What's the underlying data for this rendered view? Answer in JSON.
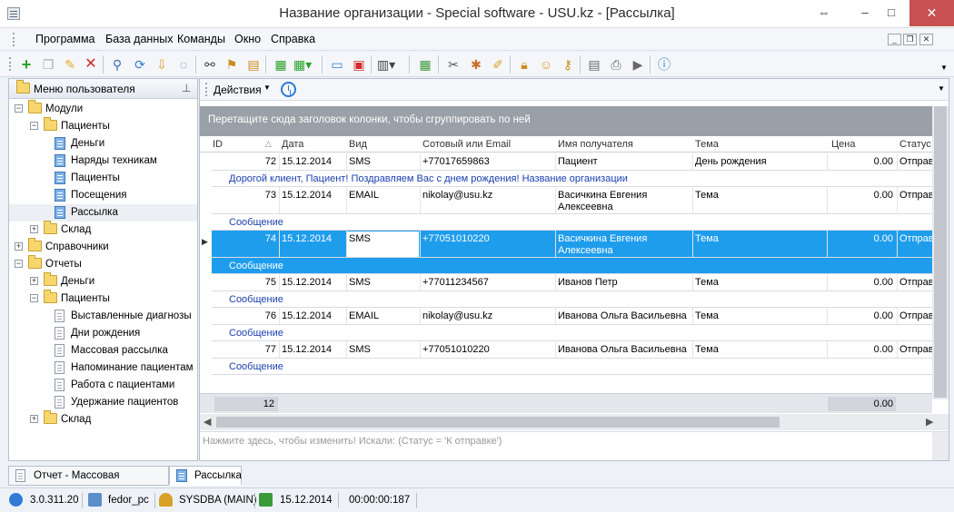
{
  "window": {
    "title": "Название организации - Special software - USU.kz - [Рассылка]",
    "controls": {
      "resize": "⇔",
      "minimize": "–",
      "maximize": "□",
      "close": "✕"
    }
  },
  "menu": {
    "items": [
      "Программа",
      "База данных",
      "Команды",
      "Окно",
      "Справка"
    ],
    "mdi": {
      "minimize": "_",
      "restore": "❐",
      "close": "✕"
    }
  },
  "toolbar": {
    "icons": [
      "add-icon",
      "copy-icon",
      "edit-icon",
      "delete-icon",
      "search-icon",
      "refresh-icon",
      "import-icon",
      "comment-icon",
      "binoculars-icon",
      "filter-icon",
      "export-icon",
      "excel-icon",
      "export-menu-icon",
      "window-icon",
      "window-add-icon",
      "column-icon",
      "calendar-icon",
      "tools-icon",
      "paint-icon",
      "notepad-icon",
      "lock-icon",
      "users-icon",
      "key-icon",
      "grid-icon",
      "print-icon",
      "play-icon",
      "info-icon"
    ]
  },
  "left_panel": {
    "title": "Меню пользователя",
    "pin": "⊥",
    "tree": [
      {
        "label": "Модули",
        "level": 0,
        "expander": "−",
        "icon": "folder"
      },
      {
        "label": "Пациенты",
        "level": 1,
        "expander": "−",
        "icon": "folder"
      },
      {
        "label": "Деньги",
        "level": 2,
        "expander": "",
        "icon": "doc-blue"
      },
      {
        "label": "Наряды техникам",
        "level": 2,
        "expander": "",
        "icon": "doc-blue"
      },
      {
        "label": "Пациенты",
        "level": 2,
        "expander": "",
        "icon": "doc-blue"
      },
      {
        "label": "Посещения",
        "level": 2,
        "expander": "",
        "icon": "doc-blue"
      },
      {
        "label": "Рассылка",
        "level": 2,
        "expander": "",
        "icon": "doc-blue",
        "selected": true
      },
      {
        "label": "Склад",
        "level": 1,
        "expander": "+",
        "icon": "folder"
      },
      {
        "label": "Справочники",
        "level": 0,
        "expander": "+",
        "icon": "folder"
      },
      {
        "label": "Отчеты",
        "level": 0,
        "expander": "−",
        "icon": "folder"
      },
      {
        "label": "Деньги",
        "level": 1,
        "expander": "+",
        "icon": "folder"
      },
      {
        "label": "Пациенты",
        "level": 1,
        "expander": "−",
        "icon": "folder"
      },
      {
        "label": "Выставленные диагнозы",
        "level": 2,
        "expander": "",
        "icon": "doc-white"
      },
      {
        "label": "Дни рождения",
        "level": 2,
        "expander": "",
        "icon": "doc-white"
      },
      {
        "label": "Массовая рассылка",
        "level": 2,
        "expander": "",
        "icon": "doc-white"
      },
      {
        "label": "Напоминание пациентам",
        "level": 2,
        "expander": "",
        "icon": "doc-white"
      },
      {
        "label": "Работа с пациентами",
        "level": 2,
        "expander": "",
        "icon": "doc-white"
      },
      {
        "label": "Удержание пациентов",
        "level": 2,
        "expander": "",
        "icon": "doc-white"
      },
      {
        "label": "Склад",
        "level": 1,
        "expander": "+",
        "icon": "folder"
      }
    ]
  },
  "actions": {
    "label": "Действия",
    "caret": "▼"
  },
  "grid": {
    "group_hint": "Перетащите сюда заголовок колонки, чтобы сгруппировать по ней",
    "sort_arrow": "△",
    "columns": [
      "ID",
      "Дата",
      "Вид",
      "Сотовый или Email",
      "Имя получателя",
      "Тема",
      "Цена",
      "Статус"
    ],
    "rows": [
      {
        "id": "72",
        "date": "15.12.2014",
        "kind": "SMS",
        "contact": "+77017659863",
        "name": "Пациент",
        "name2": "",
        "topic": "День рождения",
        "price": "0.00",
        "status": "Отправ",
        "message": "Дорогой клиент, Пациент! Поздравляем Вас с днем рождения! Название организации"
      },
      {
        "id": "73",
        "date": "15.12.2014",
        "kind": "EMAIL",
        "contact": "nikolay@usu.kz",
        "name": "Васичкина Евгения",
        "name2": "Алексеевна",
        "topic": "Тема",
        "price": "0.00",
        "status": "Отправ",
        "message": "Сообщение"
      },
      {
        "id": "74",
        "date": "15.12.2014",
        "kind": "SMS",
        "contact": "+77051010220",
        "name": "Васичкина Евгения",
        "name2": "Алексеевна",
        "topic": "Тема",
        "price": "0.00",
        "status": "Отправ",
        "message": "Сообщение",
        "selected": true
      },
      {
        "id": "75",
        "date": "15.12.2014",
        "kind": "SMS",
        "contact": "+77011234567",
        "name": "Иванов Петр",
        "name2": "",
        "topic": "Тема",
        "price": "0.00",
        "status": "Отправ",
        "message": "Сообщение"
      },
      {
        "id": "76",
        "date": "15.12.2014",
        "kind": "EMAIL",
        "contact": "nikolay@usu.kz",
        "name": "Иванова Ольга Васильевна",
        "name2": "",
        "topic": "Тема",
        "price": "0.00",
        "status": "Отправ",
        "message": "Сообщение"
      },
      {
        "id": "77",
        "date": "15.12.2014",
        "kind": "SMS",
        "contact": "+77051010220",
        "name": "Иванова Ольга Васильевна",
        "name2": "",
        "topic": "Тема",
        "price": "0.00",
        "status": "Отправ",
        "message": "Сообщение"
      }
    ],
    "footer": {
      "count": "12",
      "sum": "0.00"
    },
    "filter_text": "Нажмите здесь, чтобы изменить! Искали: (Статус = 'К отправке')"
  },
  "doc_tabs": [
    "Отчет - Массовая рассылка",
    "Рассылка"
  ],
  "status": {
    "version": "3.0.311.20",
    "computer": "fedor_pc",
    "user": "SYSDBA (MAIN)",
    "date": "15.12.2014",
    "timer": "00:00:00:187"
  },
  "colors": {
    "selection": "#1f9ded",
    "message_text": "#1a3fb0",
    "group_bar": "#9aa0a7",
    "close_button": "#c75050"
  }
}
